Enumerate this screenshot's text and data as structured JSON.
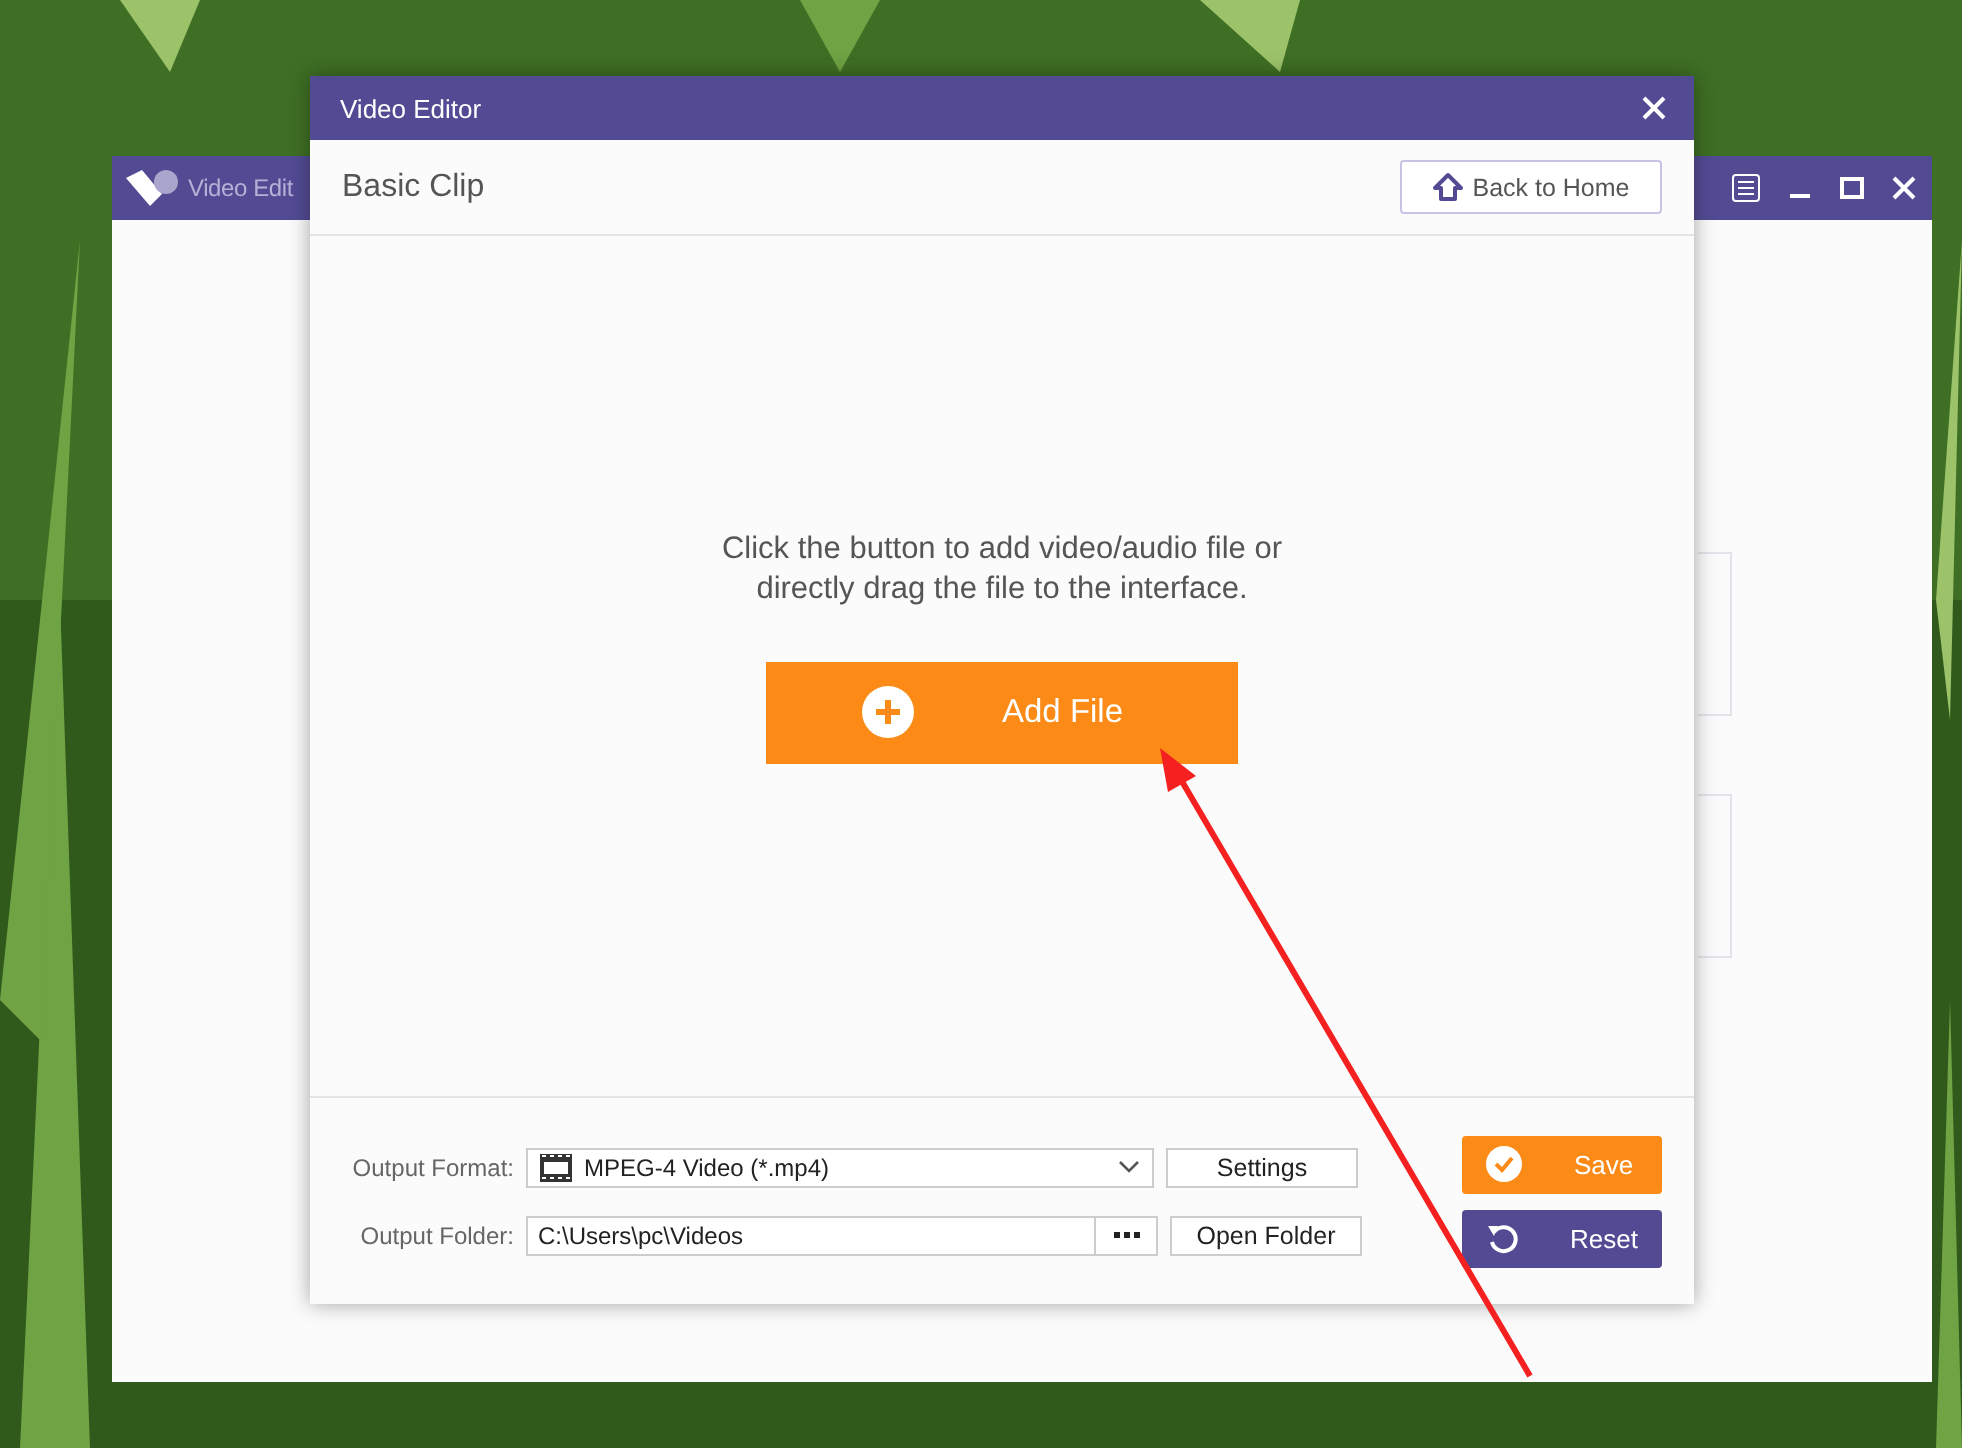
{
  "background_window": {
    "title": "Video Edit"
  },
  "dialog": {
    "title": "Video Editor",
    "header": {
      "title": "Basic Clip",
      "back_button": "Back to Home"
    },
    "prompt_lines": [
      "Click the button to add video/audio file or",
      "directly drag the file to the interface."
    ],
    "add_button": "Add File",
    "output_format": {
      "label": "Output Format:",
      "value": "MPEG-4 Video (*.mp4)"
    },
    "settings_button": "Settings",
    "output_folder": {
      "label": "Output Folder:",
      "value": "C:\\Users\\pc\\Videos"
    },
    "open_folder_button": "Open Folder",
    "save_button": "Save",
    "reset_button": "Reset"
  }
}
